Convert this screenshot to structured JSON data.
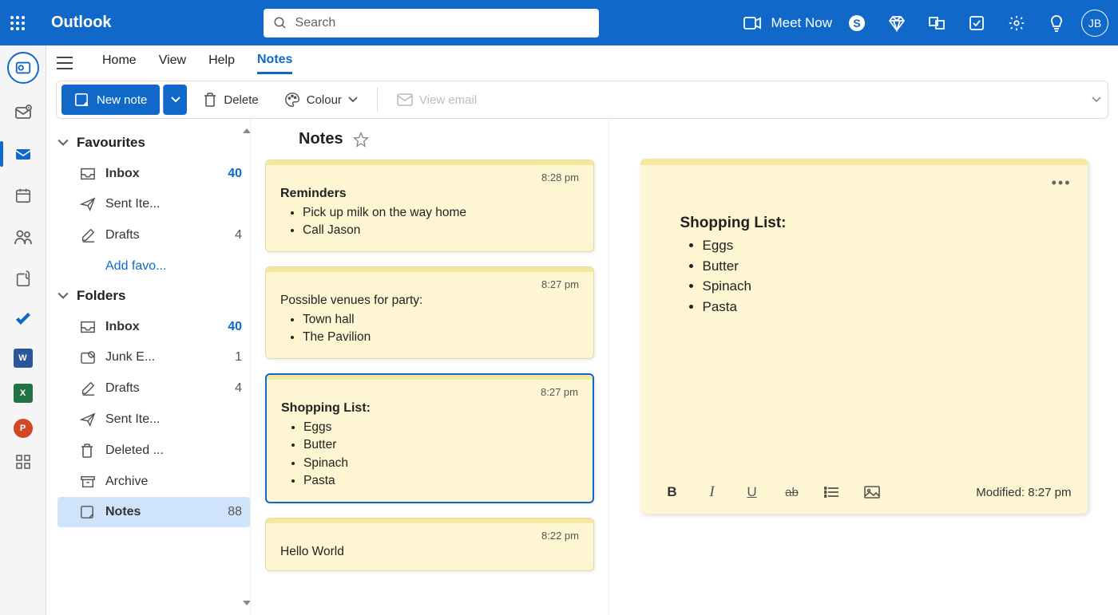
{
  "header": {
    "app_title": "Outlook",
    "search_placeholder": "Search",
    "meet_now": "Meet Now",
    "avatar_initials": "JB"
  },
  "tabs": {
    "home": "Home",
    "view": "View",
    "help": "Help",
    "notes": "Notes"
  },
  "toolbar": {
    "new_note": "New note",
    "delete": "Delete",
    "colour": "Colour",
    "view_email": "View email"
  },
  "folder_panel": {
    "favourites_header": "Favourites",
    "favourites": [
      {
        "label": "Inbox",
        "count": "40",
        "bold": true,
        "icon": "inbox"
      },
      {
        "label": "Sent Ite...",
        "count": "",
        "bold": false,
        "icon": "send"
      },
      {
        "label": "Drafts",
        "count": "4",
        "bold": false,
        "icon": "draft"
      }
    ],
    "add_favourite": "Add favo...",
    "folders_header": "Folders",
    "folders": [
      {
        "label": "Inbox",
        "count": "40",
        "bold": true,
        "icon": "inbox"
      },
      {
        "label": "Junk E...",
        "count": "1",
        "bold": false,
        "icon": "junk"
      },
      {
        "label": "Drafts",
        "count": "4",
        "bold": false,
        "icon": "draft"
      },
      {
        "label": "Sent Ite...",
        "count": "",
        "bold": false,
        "icon": "send"
      },
      {
        "label": "Deleted ...",
        "count": "",
        "bold": false,
        "icon": "trash"
      },
      {
        "label": "Archive",
        "count": "",
        "bold": false,
        "icon": "archive"
      },
      {
        "label": "Notes",
        "count": "88",
        "bold": false,
        "icon": "notes",
        "selected": true
      }
    ]
  },
  "notes_list": {
    "header": "Notes",
    "items": [
      {
        "time": "8:28 pm",
        "title": "Reminders",
        "bullets": [
          "Pick up milk on the way home",
          "Call Jason"
        ],
        "selected": false
      },
      {
        "time": "8:27 pm",
        "first_line": "Possible venues for party:",
        "bullets": [
          "Town hall",
          "The Pavilion"
        ],
        "selected": false
      },
      {
        "time": "8:27 pm",
        "title": "Shopping List:",
        "bullets": [
          "Eggs",
          "Butter",
          "Spinach",
          "Pasta"
        ],
        "selected": true
      },
      {
        "time": "8:22 pm",
        "first_line": "Hello World",
        "bullets": [],
        "selected": false
      }
    ]
  },
  "editor": {
    "title": "Shopping List:",
    "bullets": [
      "Eggs",
      "Butter",
      "Spinach",
      "Pasta"
    ],
    "modified": "Modified: 8:27 pm"
  }
}
